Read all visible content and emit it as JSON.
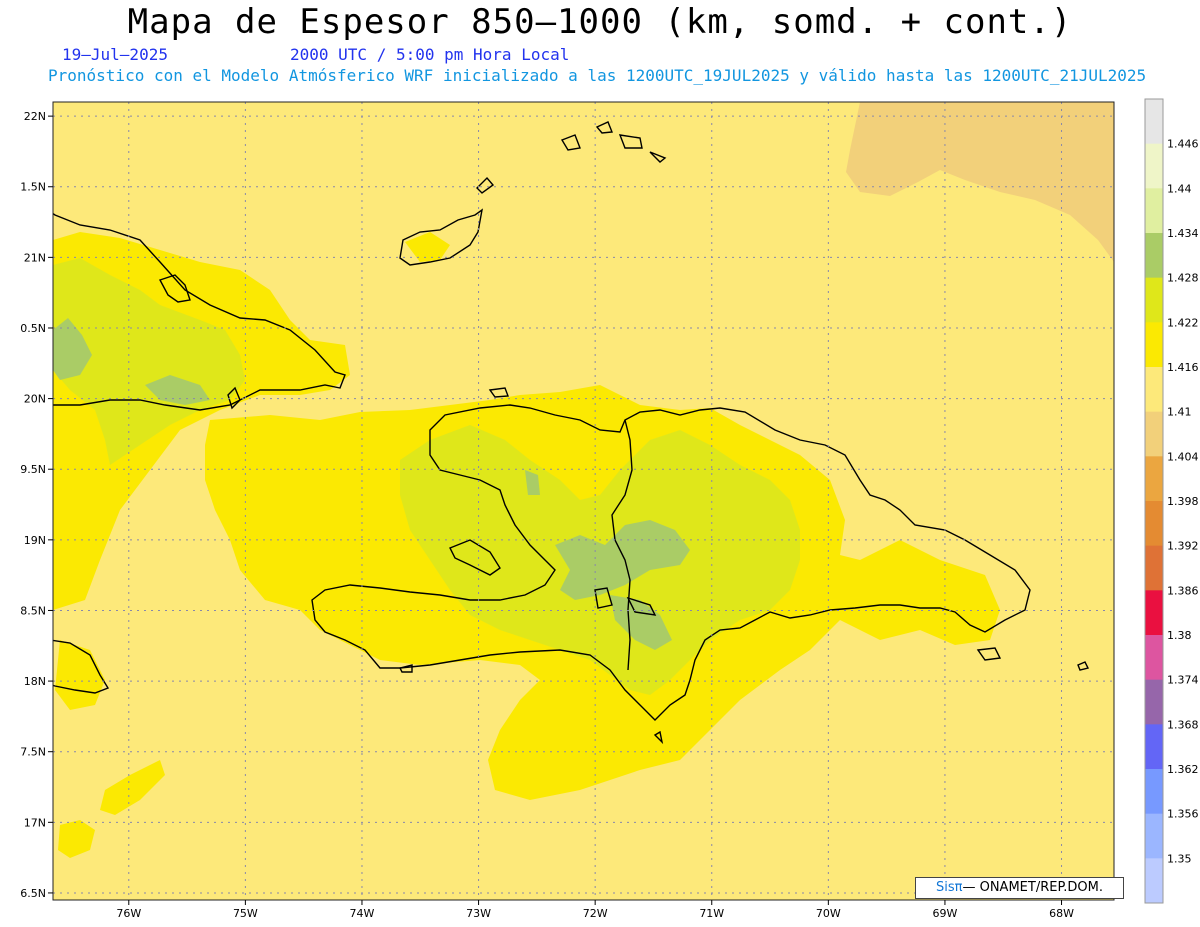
{
  "title": "Mapa de Espesor 850—1000 (km, somd. + cont.)",
  "date": "19—Jul—2025",
  "valid_time": "2000 UTC / 5:00 pm Hora Local",
  "forecast_info": "Pronóstico con el Modelo Atmósferico WRF inicializado a las 1200UTC_19JUL2025 y válido hasta las  1200UTC_21JUL2025",
  "credit": {
    "sis": "Sisπ",
    "rest": "— ONAMET/REP.DOM."
  },
  "map": {
    "lon_range": [
      -76.65,
      -67.55
    ],
    "lat_range": [
      16.45,
      22.1
    ],
    "lon_labels": [
      "76W",
      "75W",
      "74W",
      "73W",
      "72W",
      "71W",
      "70W",
      "69W",
      "68W"
    ],
    "lon_values": [
      -76,
      -75,
      -74,
      -73,
      -72,
      -71,
      -70,
      -69,
      -68
    ],
    "lat_labels": [
      "22N",
      "1.5N",
      "21N",
      "0.5N",
      "20N",
      "9.5N",
      "19N",
      "8.5N",
      "18N",
      "7.5N",
      "17N",
      "6.5N"
    ],
    "lat_values": [
      22,
      21.5,
      21,
      20.5,
      20,
      19.5,
      19,
      18.5,
      18,
      17.5,
      17,
      16.5
    ]
  },
  "colorbar": {
    "labels": [
      "1.446",
      "1.44",
      "1.434",
      "1.428",
      "1.422",
      "1.416",
      "1.41",
      "1.404",
      "1.398",
      "1.392",
      "1.386",
      "1.38",
      "1.374",
      "1.368",
      "1.362",
      "1.356",
      "1.35"
    ],
    "colors": [
      "#e6e6e6",
      "#eff5c8",
      "#e0efa0",
      "#aacc66",
      "#dfe71a",
      "#fbe902",
      "#fde97a",
      "#f2d07a",
      "#eba640",
      "#e48b32",
      "#df7236",
      "#ea1040",
      "#dd55a0",
      "#9666aa",
      "#6366f6",
      "#7799ff",
      "#9bb6ff",
      "#bccbff"
    ]
  },
  "colors": {
    "base": "#fde97a",
    "ne_lower": "#f2d07a",
    "band_1416": "#fbe902",
    "band_1422": "#dfe71a",
    "band_1428": "#aacc66",
    "coast": "#000000"
  }
}
